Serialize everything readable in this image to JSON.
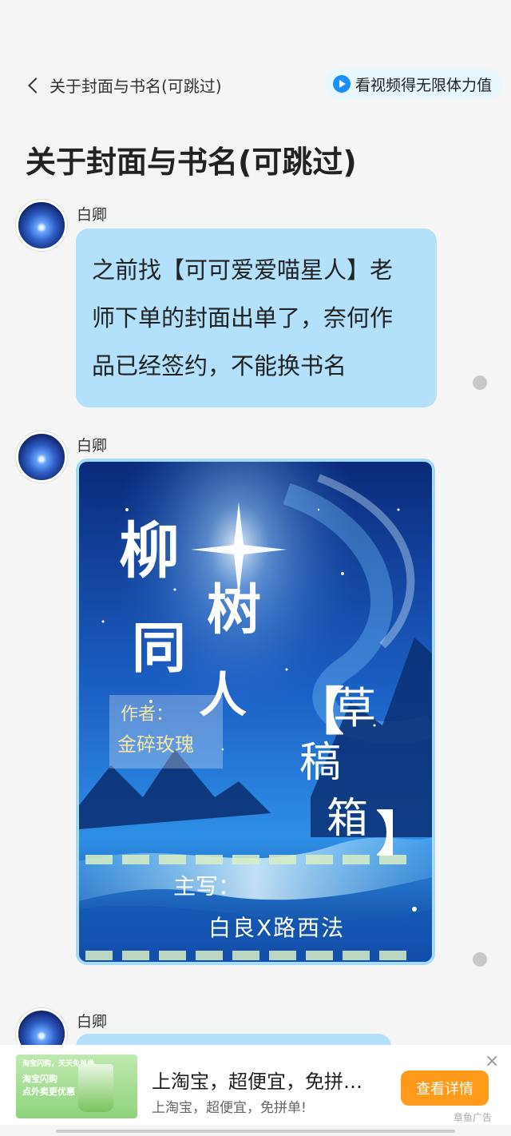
{
  "topbar": {
    "back_label": "关于封面与书名(可跳过)",
    "video_button_label": "看视频得无限体力值"
  },
  "page_title": "关于封面与书名(可跳过)",
  "messages": [
    {
      "sender": "白卿",
      "type": "text",
      "text_lines": [
        "之前找【可可爱爱喵星人】老",
        "师下单的封面出单了，奈何作",
        "品已经签约，不能换书名"
      ]
    },
    {
      "sender": "白卿",
      "type": "image",
      "image": {
        "title_chars": [
          "柳",
          "树",
          "同",
          "人"
        ],
        "author_label": "作者：",
        "author_name": "金碎玫瑰",
        "tag_open": "【",
        "tag_chars": [
          "草",
          "稿",
          "箱"
        ],
        "tag_close": "】",
        "lead_label": "主写：",
        "lead_names": "白良X路西法"
      }
    },
    {
      "sender": "白卿",
      "type": "text",
      "text_lines": []
    }
  ],
  "ad": {
    "title": "上淘宝，超便宜，免拼…",
    "subtitle": "上淘宝，超便宜，免拼单!",
    "button_label": "查看详情",
    "close_icon": "×",
    "tag": "章鱼广告",
    "thumb_lines": [
      "淘宝闪购",
      "点外卖更优惠",
      "淘宝闪购，天天免单券"
    ]
  },
  "colors": {
    "bubble": "#b3e1fb",
    "accent": "#ff9a1a",
    "play": "#1a8fff"
  }
}
